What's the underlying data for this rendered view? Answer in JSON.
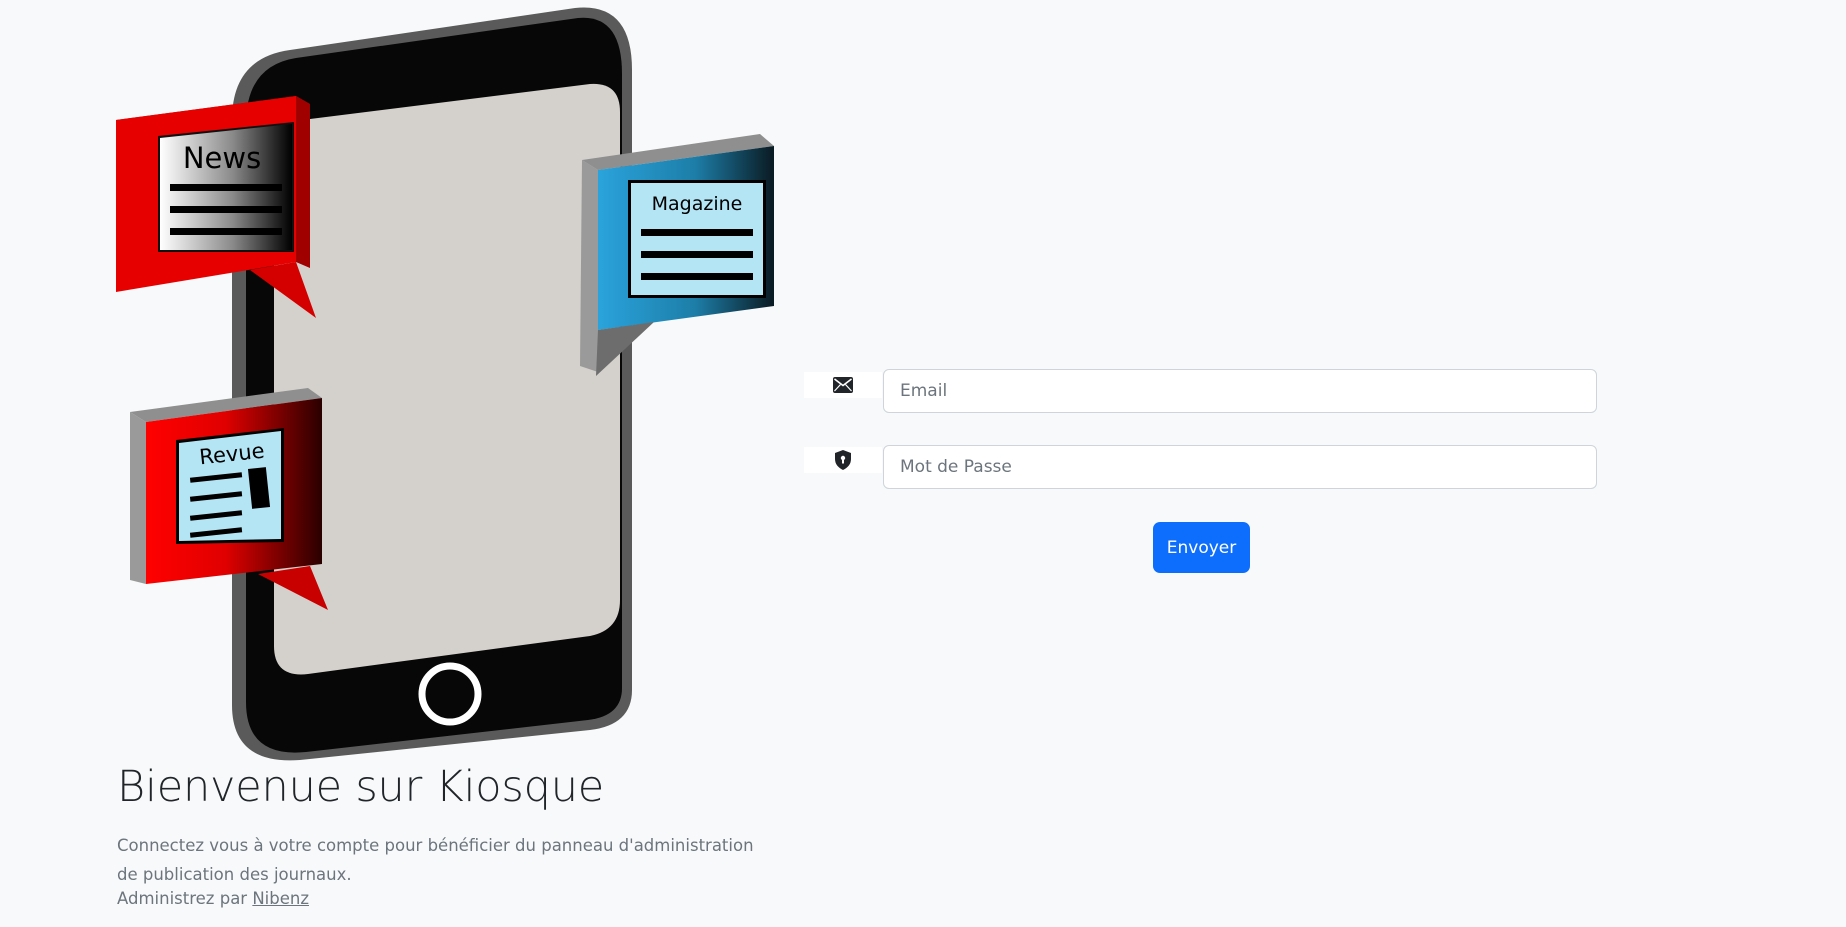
{
  "illustration": {
    "news_label": "News",
    "magazine_label": "Magazine",
    "revue_label": "Revue"
  },
  "welcome": {
    "title": "Bienvenue sur Kiosque",
    "text": "Connectez vous à votre compte pour bénéficier du panneau d'administration de publication des journaux.",
    "admin_prefix": "Administrez par ",
    "admin_link": "Nibenz"
  },
  "form": {
    "email_icon": "envelope-icon",
    "email_placeholder": "Email",
    "password_icon": "shield-lock-icon",
    "password_placeholder": "Mot de Passe",
    "submit_label": "Envoyer"
  },
  "colors": {
    "background": "#f8f9fa",
    "primary": "#0d6efd",
    "news_red": "#e60000",
    "magazine_blue": "#2a9fd6",
    "paper_blue": "#b3e5f5"
  }
}
